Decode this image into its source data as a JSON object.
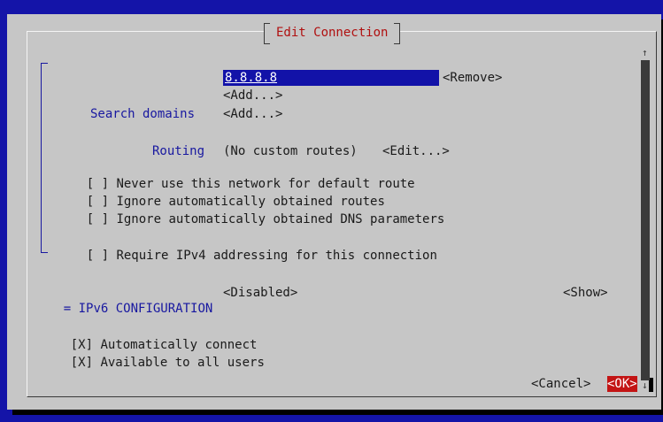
{
  "dialog": {
    "title": "Edit Connection"
  },
  "dns": {
    "value": "8.8.8.8",
    "remove_label": "<Remove>",
    "add_label": "<Add...>"
  },
  "search_domains": {
    "label": "Search domains",
    "add_label": "<Add...>"
  },
  "routing": {
    "label": "Routing",
    "value": "(No custom routes)",
    "edit_label": "<Edit...>"
  },
  "ipv4_options": [
    {
      "checkbox": "[ ]",
      "label": "Never use this network for default route"
    },
    {
      "checkbox": "[ ]",
      "label": "Ignore automatically obtained routes"
    },
    {
      "checkbox": "[ ]",
      "label": "Ignore automatically obtained DNS parameters"
    },
    {
      "checkbox": "[ ]",
      "label": "Require IPv4 addressing for this connection"
    }
  ],
  "ipv6": {
    "marker": "=",
    "label": "IPv6 CONFIGURATION",
    "mode": "<Disabled>",
    "show_label": "<Show>"
  },
  "general_options": [
    {
      "checkbox": "[X]",
      "label": "Automatically connect"
    },
    {
      "checkbox": "[X]",
      "label": "Available to all users"
    }
  ],
  "buttons": {
    "cancel": "<Cancel>",
    "ok": "<OK>"
  },
  "scroll": {
    "up_icon": "↑",
    "down_icon": "↓"
  }
}
